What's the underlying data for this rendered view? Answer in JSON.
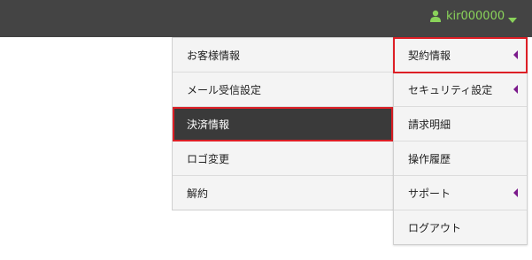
{
  "header": {
    "username": "kir000000",
    "user_icon": "user-icon",
    "caret_icon": "caret-down-icon",
    "username_color": "#8ad35a"
  },
  "submenu": {
    "items": [
      {
        "label": "お客様情報"
      },
      {
        "label": "メール受信設定"
      },
      {
        "label": "決済情報",
        "selected": true
      },
      {
        "label": "ロゴ変更"
      },
      {
        "label": "解約"
      }
    ]
  },
  "mainmenu": {
    "items": [
      {
        "label": "契約情報",
        "has_submenu": true,
        "highlighted": true
      },
      {
        "label": "セキュリティ設定",
        "has_submenu": true
      },
      {
        "label": "請求明細"
      },
      {
        "label": "操作履歴"
      },
      {
        "label": "サポート",
        "has_submenu": true
      },
      {
        "label": "ログアウト"
      }
    ]
  },
  "colors": {
    "topbar": "#444444",
    "highlight_border": "#dd1f26",
    "selected_bg": "#3a3a3a",
    "submenu_arrow": "#7b1a8b"
  }
}
